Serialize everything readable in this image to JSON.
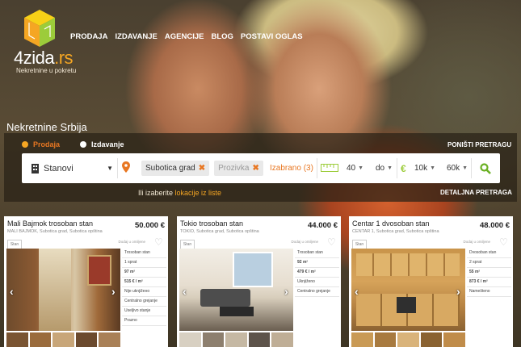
{
  "brand": {
    "name_main": "4zida",
    "name_tld": ".rs",
    "tagline": "Nekretnine u pokretu",
    "accent": "#f5a623"
  },
  "nav": [
    "PRODAJA",
    "IZDAVANJE",
    "AGENCIJE",
    "BLOG",
    "POSTAVI OGLAS"
  ],
  "page_title": "Nekretnine Srbija",
  "search": {
    "mode_sale": "Prodaja",
    "mode_rent": "Izdavanje",
    "reset": "PONIŠTI PRETRAGU",
    "type": "Stanovi",
    "locations": [
      "Subotica grad",
      "Prozivka"
    ],
    "selected": "Izabrano (3)",
    "area_from": "40",
    "area_to": "do",
    "currency": "€",
    "price_from": "10k",
    "price_to": "60k",
    "hint_prefix": "Ili izaberite",
    "hint_link": "lokacije iz liste",
    "detailed": "DETALJNA PRETRAGA"
  },
  "cards": [
    {
      "title": "Mali Bajmok trosoban stan",
      "location": "MALI BAJMOK, Subotica grad, Subotica opština",
      "price": "50.000 €",
      "badge": "Stan",
      "fav": "Dodaj u omiljene",
      "props": [
        "Trosoban stan",
        "1 sprat",
        "97 m²",
        "515 € / m²",
        "Nije uknjižено",
        "Centralno grejanje",
        "Useljivo stanje",
        "Prazno"
      ]
    },
    {
      "title": "Tokio trosoban stan",
      "location": "TOKIO, Subotica grad, Subotica opština",
      "price": "44.000 €",
      "badge": "Stan",
      "fav": "Dodaj u omiljene",
      "props": [
        "Trosoban stan",
        "92 m²",
        "479 € / m²",
        "Uknjiženo",
        "Centralno grejanje"
      ]
    },
    {
      "title": "Centar 1 dvosoban stan",
      "location": "CENTAR 1, Subotica grad, Subotica opština",
      "price": "48.000 €",
      "badge": "Stan",
      "fav": "Dodaj u omiljene",
      "props": [
        "Dvosoban stan",
        "2 sprat",
        "55 m²",
        "873 € / m²",
        "Namešteno"
      ]
    }
  ]
}
